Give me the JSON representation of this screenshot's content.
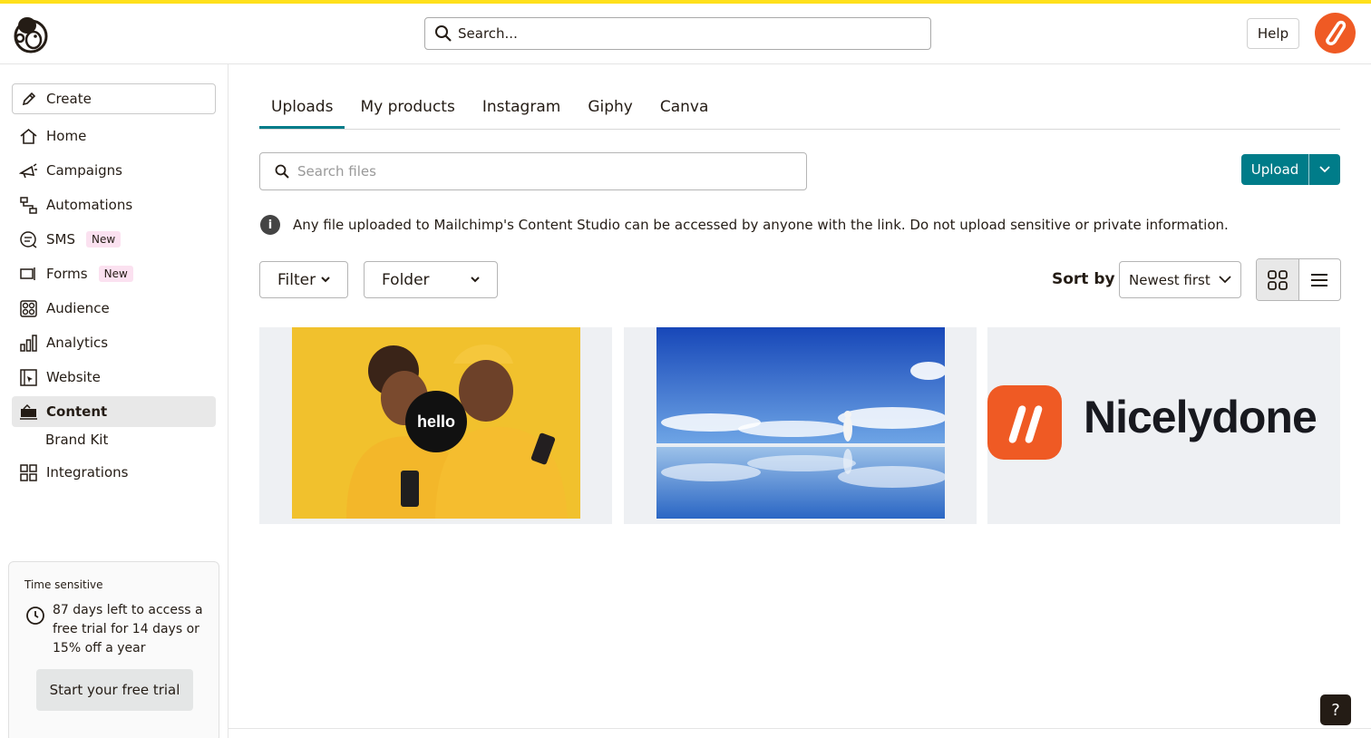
{
  "header": {
    "search_placeholder": "Search...",
    "help_label": "Help"
  },
  "sidebar": {
    "create_label": "Create",
    "items": [
      {
        "label": "Home"
      },
      {
        "label": "Campaigns"
      },
      {
        "label": "Automations"
      },
      {
        "label": "SMS",
        "badge": "New"
      },
      {
        "label": "Forms",
        "badge": "New"
      },
      {
        "label": "Audience"
      },
      {
        "label": "Analytics"
      },
      {
        "label": "Website"
      },
      {
        "label": "Content"
      },
      {
        "label": "Brand Kit"
      },
      {
        "label": "Integrations"
      }
    ],
    "active_item": "Content"
  },
  "trial": {
    "heading": "Time sensitive",
    "message": "87 days left to access a free trial for 14 days or 15% off a year",
    "button_label": "Start your free trial"
  },
  "content": {
    "tabs": [
      "Uploads",
      "My products",
      "Instagram",
      "Giphy",
      "Canva"
    ],
    "active_tab": "Uploads",
    "search_placeholder": "Search files",
    "upload_label": "Upload",
    "notice": "Any file uploaded to Mailchimp's Content Studio can be accessed by anyone with the link. Do not upload sensitive or private information.",
    "filter_label": "Filter",
    "folder_label": "Folder",
    "sort_label": "Sort by",
    "sort_value": "Newest first",
    "view_mode": "grid",
    "files": [
      {
        "overlay_text": "hello"
      },
      {
        "overlay_text": ""
      },
      {
        "overlay_text": "Nicelydone"
      }
    ]
  },
  "help_fab_label": "?",
  "colors": {
    "accent": "#007c89",
    "brand_yellow": "#ffe01b",
    "avatar": "#ef5a24"
  }
}
